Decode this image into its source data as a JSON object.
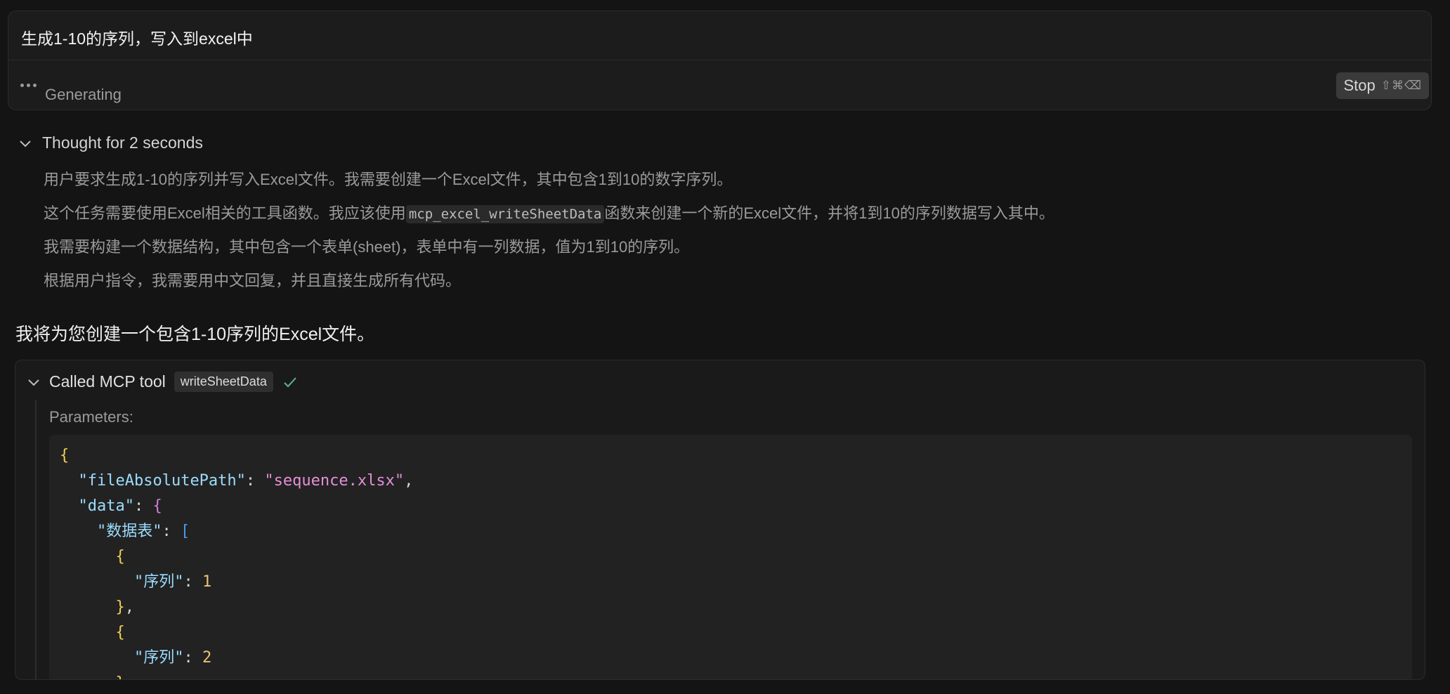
{
  "prompt": {
    "text": "生成1-10的序列，写入到excel中",
    "status": "Generating",
    "stop_label": "Stop",
    "stop_shortcut": "⇧⌘⌫"
  },
  "thought": {
    "title": "Thought for 2 seconds",
    "lines": [
      {
        "pre": "用户要求生成1-10的序列并写入Excel文件。我需要创建一个Excel文件，其中包含1到10的数字序列。",
        "code": "",
        "post": ""
      },
      {
        "pre": "这个任务需要使用Excel相关的工具函数。我应该使用",
        "code": "mcp_excel_writeSheetData",
        "post": "函数来创建一个新的Excel文件，并将1到10的序列数据写入其中。"
      },
      {
        "pre": "我需要构建一个数据结构，其中包含一个表单(sheet)，表单中有一列数据，值为1到10的序列。",
        "code": "",
        "post": ""
      },
      {
        "pre": "根据用户指令，我需要用中文回复，并且直接生成所有代码。",
        "code": "",
        "post": ""
      }
    ]
  },
  "answer": "我将为您创建一个包含1-10序列的Excel文件。",
  "tool": {
    "title": "Called MCP tool",
    "name": "writeSheetData",
    "params_label": "Parameters:",
    "code": {
      "key_path": "\"fileAbsolutePath\"",
      "val_path": "\"sequence.xlsx\"",
      "key_data": "\"data\"",
      "key_sheet": "\"数据表\"",
      "key_seq": "\"序列\"",
      "val_1": "1",
      "val_2": "2"
    }
  },
  "colors": {
    "background": "#141414",
    "card": "#1c1c1c",
    "check": "#5fb58a",
    "string": "#e48fd7",
    "key": "#9cdcfe",
    "number": "#e9c27a"
  }
}
